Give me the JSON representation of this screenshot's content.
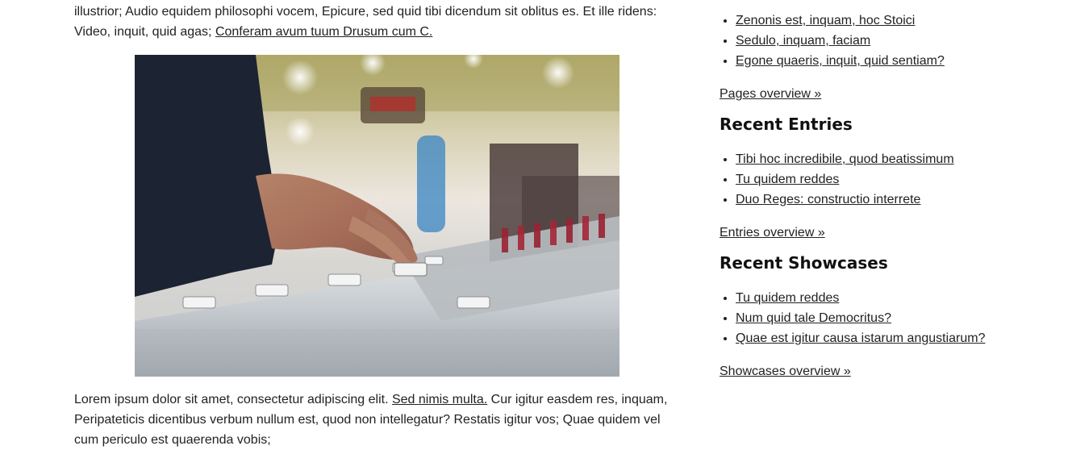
{
  "main": {
    "top_para_text_1": "illustrior; Audio equidem philosophi vocem, Epicure, sed quid tibi dicendum sit oblitus es. Et ille ridens: Video, inquit, quid agas; ",
    "top_para_link": "Conferam avum tuum Drusum cum C.",
    "image_alt": "Hand adjusting faders on a mixing console",
    "bottom_para_text_1": "Lorem ipsum dolor sit amet, consectetur adipiscing elit. ",
    "bottom_para_link": "Sed nimis multa.",
    "bottom_para_text_2": " Cur igitur easdem res, inquam, Peripateticis dicentibus verbum nullum est, quod non intellegatur? Restatis igitur vos; Quae quidem vel cum periculo est quaerenda vobis;"
  },
  "sidebar": {
    "pages_items": [
      "Zenonis est, inquam, hoc Stoici",
      "Sedulo, inquam, faciam",
      "Egone quaeris, inquit, quid sentiam?"
    ],
    "pages_overview": "Pages overview »",
    "entries_heading": "Recent Entries",
    "entries_items": [
      "Tibi hoc incredibile, quod beatissimum",
      "Tu quidem reddes",
      "Duo Reges: constructio interrete"
    ],
    "entries_overview": "Entries overview »",
    "showcases_heading": "Recent Showcases",
    "showcases_items": [
      "Tu quidem reddes",
      "Num quid tale Democritus?",
      "Quae est igitur causa istarum angustiarum?"
    ],
    "showcases_overview": "Showcases overview »"
  }
}
